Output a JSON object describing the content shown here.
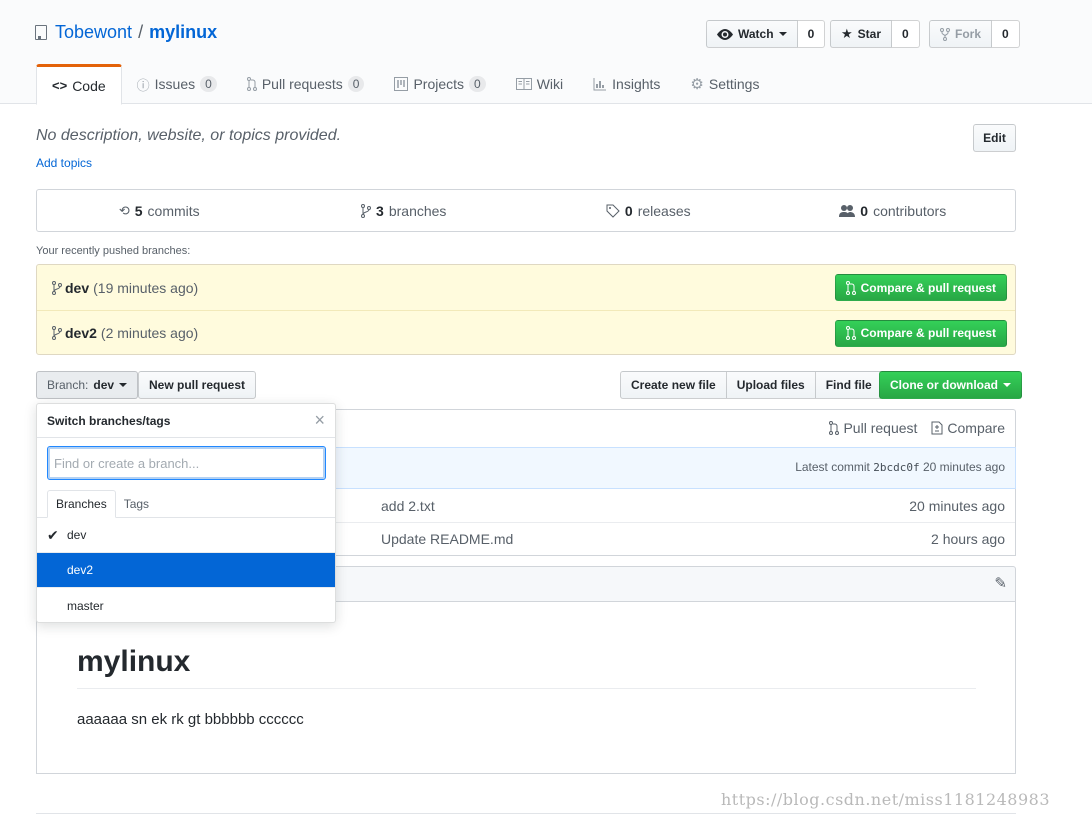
{
  "repo": {
    "owner": "Tobewont",
    "separator": "/",
    "name": "mylinux"
  },
  "actions": {
    "watch_label": "Watch",
    "watch_count": "0",
    "star_label": "Star",
    "star_count": "0",
    "fork_label": "Fork",
    "fork_count": "0"
  },
  "tabs": [
    {
      "label": "Code",
      "icon": "code-icon"
    },
    {
      "label": "Issues",
      "count": "0",
      "icon": "issue-icon"
    },
    {
      "label": "Pull requests",
      "count": "0",
      "icon": "pull-request-icon"
    },
    {
      "label": "Projects",
      "count": "0",
      "icon": "project-icon"
    },
    {
      "label": "Wiki",
      "icon": "book-icon"
    },
    {
      "label": "Insights",
      "icon": "graph-icon"
    },
    {
      "label": "Settings",
      "icon": "gear-icon"
    }
  ],
  "description": "No description, website, or topics provided.",
  "add_topics": "Add topics",
  "edit_label": "Edit",
  "summary": {
    "commits_num": "5",
    "commits_label": "commits",
    "branches_num": "3",
    "branches_label": "branches",
    "releases_num": "0",
    "releases_label": "releases",
    "contributors_num": "0",
    "contributors_label": "contributors"
  },
  "recent": {
    "label": "Your recently pushed branches:",
    "items": [
      {
        "branch": "dev",
        "time": "(19 minutes ago)",
        "button": "Compare & pull request"
      },
      {
        "branch": "dev2",
        "time": "(2 minutes ago)",
        "button": "Compare & pull request"
      }
    ]
  },
  "filenav": {
    "branch_prefix": "Branch:",
    "branch_value": "dev",
    "new_pr": "New pull request",
    "create_file": "Create new file",
    "upload_files": "Upload files",
    "find_file": "Find file",
    "clone": "Clone or download"
  },
  "commit_tease": {
    "pull_request": "Pull request",
    "compare": "Compare",
    "latest_label": "Latest commit",
    "sha": "2bcdc0f",
    "time": "20 minutes ago"
  },
  "files": [
    {
      "message": "add 2.txt",
      "age": "20 minutes ago"
    },
    {
      "message": "Update README.md",
      "age": "2 hours ago"
    }
  ],
  "readme": {
    "title": "mylinux",
    "body": "aaaaaa sn ek rk gt bbbbbb cccccc"
  },
  "dropdown": {
    "title": "Switch branches/tags",
    "placeholder": "Find or create a branch...",
    "tab_branches": "Branches",
    "tab_tags": "Tags",
    "items": [
      {
        "name": "dev",
        "checked": true
      },
      {
        "name": "dev2",
        "highlighted": true
      },
      {
        "name": "master"
      }
    ]
  },
  "watermark": "https://blog.csdn.net/miss1181248983",
  "colors": {
    "accent": "#0366d6",
    "green": "#28a745",
    "tab_orange": "#e36209",
    "highlight": "#fffbdd"
  }
}
